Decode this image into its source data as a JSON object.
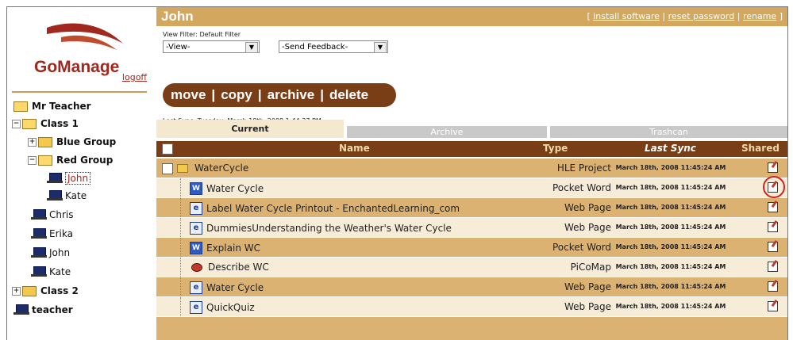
{
  "app": {
    "logo_text": "GoManage",
    "logoff": "logoff"
  },
  "colors": {
    "brand_red": "#a0281e",
    "tan": "#d3a75e",
    "brown": "#7a3e16",
    "row_dark": "#dcb272",
    "row_light": "#f6ecd8"
  },
  "tree": {
    "root": "Mr Teacher",
    "class1": "Class 1",
    "blue_group": "Blue Group",
    "red_group": "Red Group",
    "john_selected": "John",
    "kate_group": "Kate",
    "chris": "Chris",
    "erika": "Erika",
    "john": "John",
    "kate": "Kate",
    "class2": "Class 2",
    "teacher": "teacher",
    "exp_minus": "−",
    "exp_plus": "+"
  },
  "header": {
    "title": "John",
    "links": {
      "install": "install software",
      "reset": "reset password",
      "rename": "rename",
      "open": "[",
      "close": "]",
      "sep": "|"
    }
  },
  "filters": {
    "label": "View Filter: Default Filter",
    "view_select": "-View-",
    "feedback_select": "-Send Feedback-",
    "arrow": "▼"
  },
  "actions": {
    "move": "move",
    "copy": "copy",
    "archive": "archive",
    "delete": "delete",
    "sep": "|"
  },
  "last_sync": "Last Sync: Tuesday, March 18th, 2008 1:44:27 PM",
  "tabs": {
    "current": "Current",
    "archive": "Archive",
    "trash": "Trashcan"
  },
  "table": {
    "columns": {
      "name": "Name",
      "type": "Type",
      "last_sync": "Last Sync",
      "shared": "Shared"
    },
    "rows": [
      {
        "name": "WaterCycle",
        "type": "HLE Project",
        "sync": "March 18th, 2008 11:45:24 AM",
        "icon": "project-icon"
      },
      {
        "name": "Water Cycle",
        "type": "Pocket Word",
        "sync": "March 18th, 2008 11:45:24 AM",
        "icon": "pocket-word-icon",
        "glyph": "W"
      },
      {
        "name": "Label Water Cycle Printout - EnchantedLearning_com",
        "type": "Web Page",
        "sync": "March 18th, 2008 11:45:24 AM",
        "icon": "web-page-icon",
        "glyph": "e"
      },
      {
        "name": "DummiesUnderstanding the Weather's Water Cycle",
        "type": "Web Page",
        "sync": "March 18th, 2008 11:45:24 AM",
        "icon": "web-page-icon",
        "glyph": "e"
      },
      {
        "name": "Explain WC",
        "type": "Pocket Word",
        "sync": "March 18th, 2008 11:45:24 AM",
        "icon": "pocket-word-icon",
        "glyph": "W"
      },
      {
        "name": "Describe WC",
        "type": "PiCoMap",
        "sync": "March 18th, 2008 11:45:24 AM",
        "icon": "picomap-icon"
      },
      {
        "name": "Water Cycle",
        "type": "Web Page",
        "sync": "March 18th, 2008 11:45:24 AM",
        "icon": "web-page-icon",
        "glyph": "e"
      },
      {
        "name": "QuickQuiz",
        "type": "Web Page",
        "sync": "March 18th, 2008 11:45:24 AM",
        "icon": "web-page-icon",
        "glyph": "e"
      }
    ]
  }
}
